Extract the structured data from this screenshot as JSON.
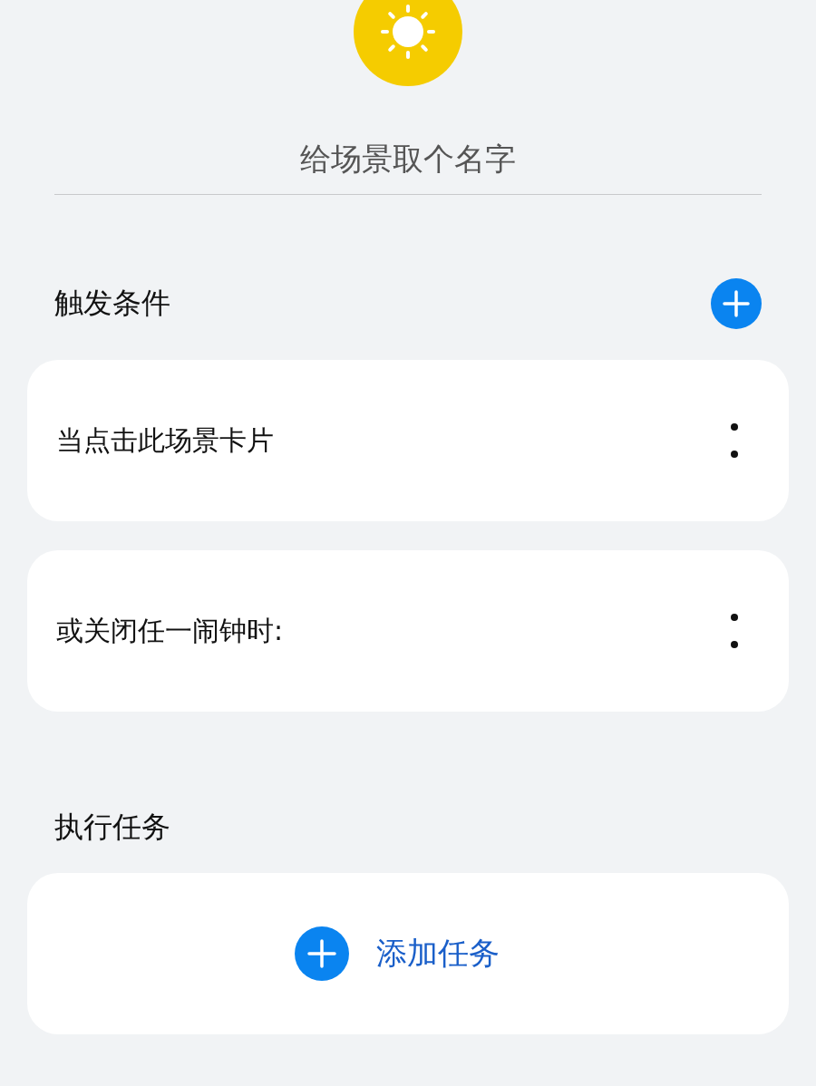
{
  "name_field": {
    "placeholder": "给场景取个名字"
  },
  "triggers": {
    "title": "触发条件",
    "conditions": [
      {
        "label": "当点击此场景卡片"
      },
      {
        "label": "或关闭任一闹钟时:"
      }
    ]
  },
  "tasks": {
    "title": "执行任务",
    "add_label": "添加任务"
  }
}
